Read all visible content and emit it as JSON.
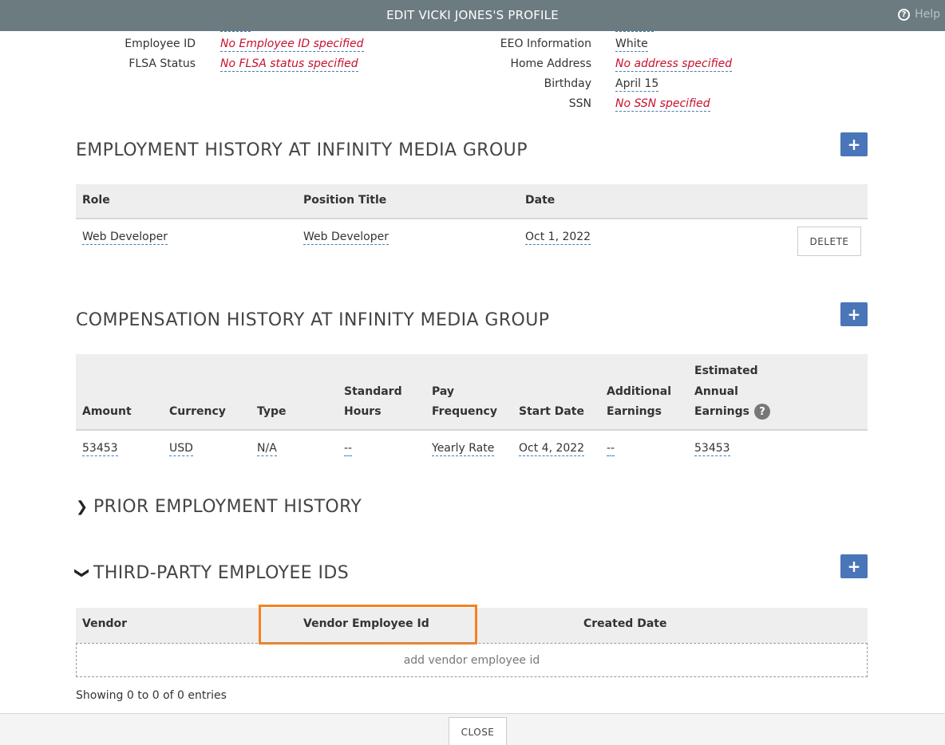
{
  "header": {
    "title": "EDIT VICKI JONES'S PROFILE",
    "help_label": "Help"
  },
  "left_fields": [
    {
      "label": "Employee ID",
      "value": "No Employee ID specified",
      "missing": true
    },
    {
      "label": "FLSA Status",
      "value": "No FLSA status specified",
      "missing": true
    }
  ],
  "right_fields": [
    {
      "label": "EEO Information",
      "value": "White",
      "missing": false
    },
    {
      "label": "Home Address",
      "value": "No address specified",
      "missing": true
    },
    {
      "label": "Birthday",
      "value": "April 15",
      "missing": false
    },
    {
      "label": "SSN",
      "value": "No SSN specified",
      "missing": true
    }
  ],
  "employment": {
    "title": "EMPLOYMENT HISTORY AT INFINITY MEDIA GROUP",
    "add_label": "+",
    "columns": [
      "Role",
      "Position Title",
      "Date"
    ],
    "rows": [
      {
        "role": "Web Developer",
        "position_title": "Web Developer",
        "date": "Oct 1, 2022",
        "delete_label": "DELETE"
      }
    ]
  },
  "compensation": {
    "title": "COMPENSATION HISTORY AT INFINITY MEDIA GROUP",
    "add_label": "+",
    "columns": {
      "amount": "Amount",
      "currency": "Currency",
      "type": "Type",
      "standard_hours_1": "Standard",
      "standard_hours_2": "Hours",
      "pay_frequency_1": "Pay",
      "pay_frequency_2": "Frequency",
      "start_date": "Start Date",
      "additional_earnings_1": "Additional",
      "additional_earnings_2": "Earnings",
      "estimated_1": "Estimated",
      "estimated_2": "Annual",
      "estimated_3": "Earnings",
      "info_glyph": "?"
    },
    "rows": [
      {
        "amount": "53453",
        "currency": "USD",
        "type": "N/A",
        "standard_hours": "--",
        "pay_frequency": "Yearly Rate",
        "start_date": "Oct 4, 2022",
        "additional_earnings": "--",
        "estimated_annual_earnings": "53453"
      }
    ]
  },
  "prior_employment": {
    "title": "PRIOR EMPLOYMENT HISTORY",
    "chevron": "❯"
  },
  "third_party": {
    "title": "THIRD-PARTY EMPLOYEE IDS",
    "chevron": "❯",
    "add_label": "+",
    "columns": [
      "Vendor",
      "Vendor Employee Id",
      "Created Date"
    ],
    "add_row_label": "add vendor employee id",
    "showing": "Showing 0 to 0 of 0 entries"
  },
  "footer": {
    "close_label": "CLOSE"
  },
  "colors": {
    "titlebar": "#6b7b80",
    "accent_button": "#4a75b8",
    "missing_text": "#c8102e",
    "highlight": "#f5821f"
  }
}
